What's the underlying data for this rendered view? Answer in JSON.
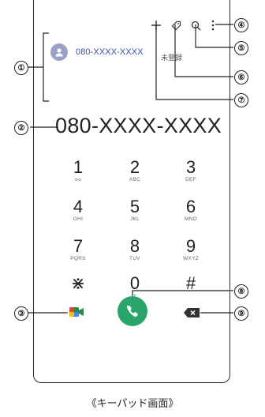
{
  "contact_suggestion": {
    "number": "080-XXXX-XXXX",
    "avatar_icon": "person-icon"
  },
  "dialed_number": "080-XXXX-XXXX",
  "unregistered_label": "未登録",
  "toolbar": {
    "add_icon": "plus-icon",
    "tag_icon": "tag-icon",
    "search_icon": "search-icon",
    "menu_icon": "more-vert-icon"
  },
  "keypad": [
    {
      "digit": "1",
      "letters": "ᴑᴑ"
    },
    {
      "digit": "2",
      "letters": "ABC"
    },
    {
      "digit": "3",
      "letters": "DEF"
    },
    {
      "digit": "4",
      "letters": "GHI"
    },
    {
      "digit": "5",
      "letters": "JKL"
    },
    {
      "digit": "6",
      "letters": "MNO"
    },
    {
      "digit": "7",
      "letters": "PQRS"
    },
    {
      "digit": "8",
      "letters": "TUV"
    },
    {
      "digit": "9",
      "letters": "WXYZ"
    },
    {
      "digit": "⋇",
      "letters": ""
    },
    {
      "digit": "0",
      "letters": "+"
    },
    {
      "digit": "#",
      "letters": ""
    }
  ],
  "actions": {
    "video_icon": "video-call-icon",
    "call_icon": "phone-icon",
    "delete_icon": "backspace-icon"
  },
  "callouts": [
    "①",
    "②",
    "③",
    "④",
    "⑤",
    "⑥",
    "⑦",
    "⑧",
    "⑨"
  ],
  "caption": "《キーパッド画面》",
  "colors": {
    "call_green": "#2aa56a",
    "link_blue": "#3a4fb0",
    "avatar": "#9aa0c8"
  }
}
